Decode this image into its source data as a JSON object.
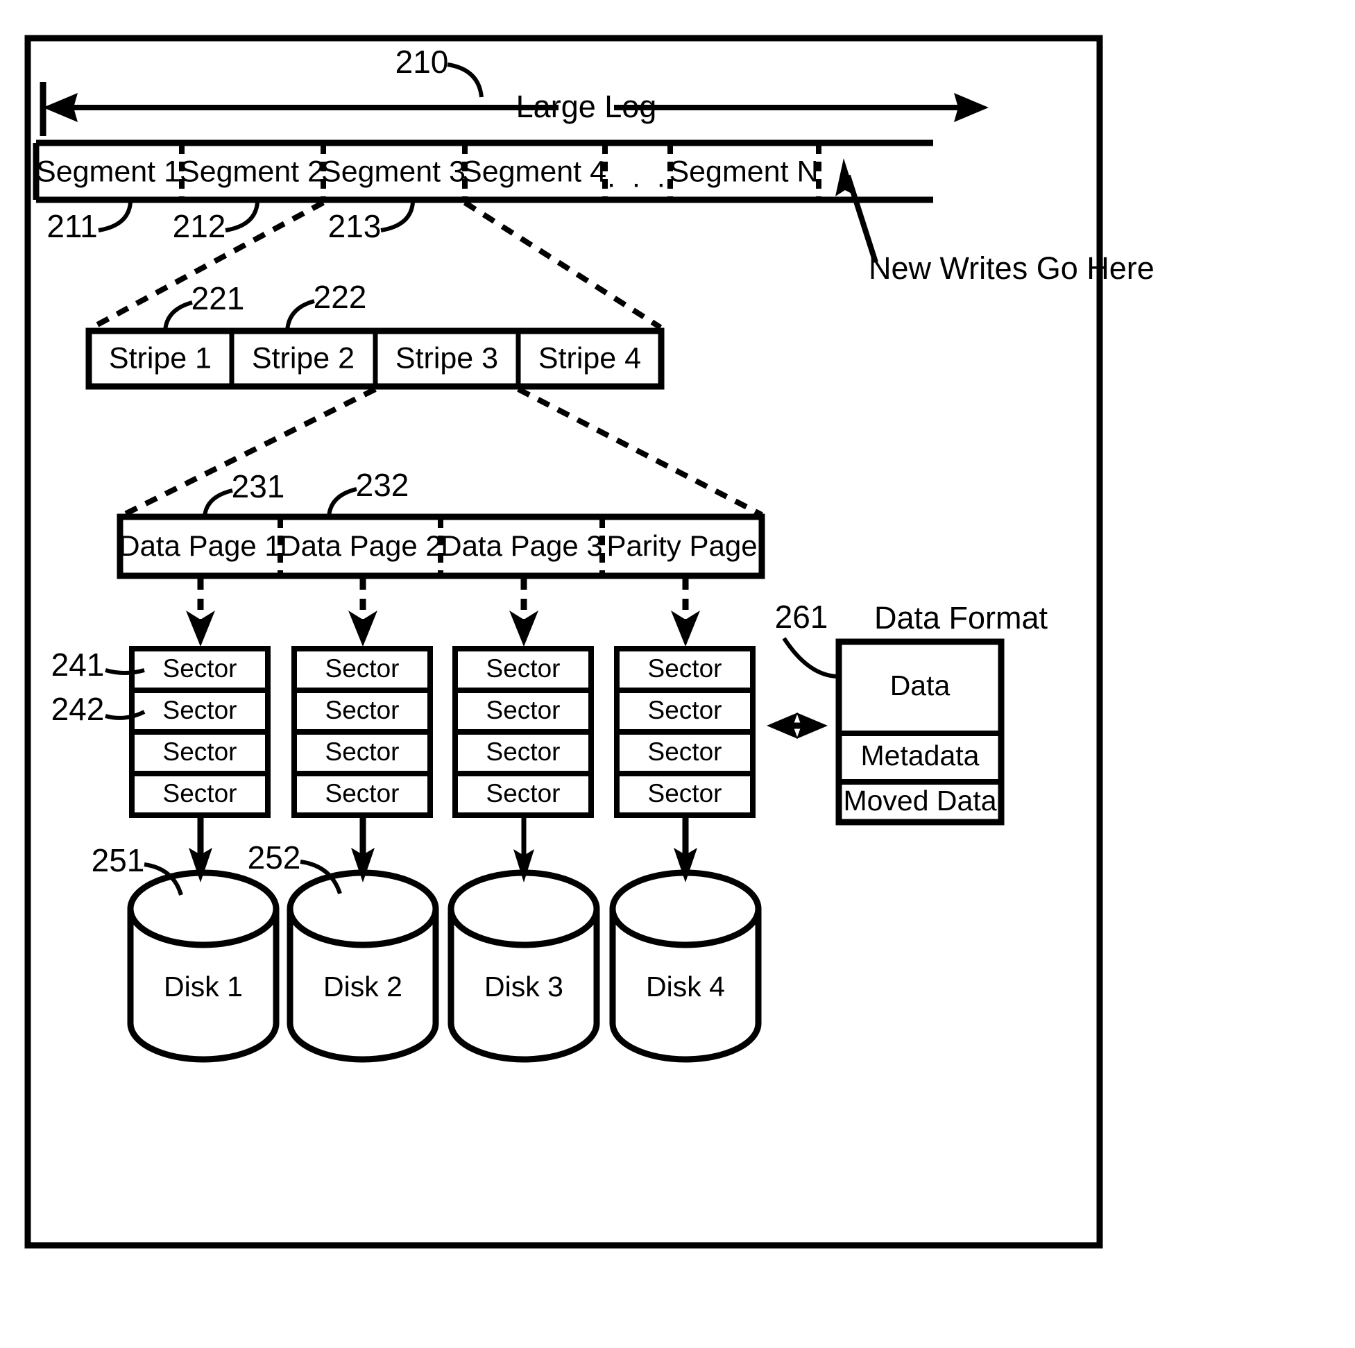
{
  "figure": {
    "title_label": "Large Log",
    "ref_210": "210",
    "note_new_writes": "New Writes Go Here",
    "data_format_title": "Data Format",
    "ref_261": "261",
    "ellipsis": ". . ."
  },
  "log": {
    "ref_210": "210",
    "label": "Large Log",
    "segments": [
      {
        "label": "Segment 1",
        "ref": "211"
      },
      {
        "label": "Segment 2",
        "ref": "212"
      },
      {
        "label": "Segment 3",
        "ref": "213"
      },
      {
        "label": "Segment 4",
        "ref": ""
      },
      {
        "label": ". . .",
        "ref": ""
      },
      {
        "label": "Segment N",
        "ref": ""
      }
    ]
  },
  "stripes": {
    "refs": [
      "221",
      "222"
    ],
    "items": [
      {
        "label": "Stripe 1"
      },
      {
        "label": "Stripe 2"
      },
      {
        "label": "Stripe 3"
      },
      {
        "label": "Stripe 4"
      }
    ]
  },
  "pages": {
    "refs": [
      "231",
      "232"
    ],
    "items": [
      {
        "label": "Data Page 1"
      },
      {
        "label": "Data Page 2"
      },
      {
        "label": "Data Page 3"
      },
      {
        "label": "Parity Page"
      }
    ]
  },
  "sectors": {
    "refs": [
      "241",
      "242"
    ],
    "label": "Sector",
    "columns": [
      {
        "cells": [
          "Sector",
          "Sector",
          "Sector",
          "Sector"
        ]
      },
      {
        "cells": [
          "Sector",
          "Sector",
          "Sector",
          "Sector"
        ]
      },
      {
        "cells": [
          "Sector",
          "Sector",
          "Sector",
          "Sector"
        ]
      },
      {
        "cells": [
          "Sector",
          "Sector",
          "Sector",
          "Sector"
        ]
      }
    ]
  },
  "disks": {
    "refs": [
      "251",
      "252"
    ],
    "items": [
      {
        "label": "Disk 1"
      },
      {
        "label": "Disk 2"
      },
      {
        "label": "Disk 3"
      },
      {
        "label": "Disk 4"
      }
    ]
  },
  "data_format": {
    "ref": "261",
    "title": "Data Format",
    "rows": [
      {
        "label": "Data"
      },
      {
        "label": "Metadata"
      },
      {
        "label": "Moved Data"
      }
    ]
  }
}
